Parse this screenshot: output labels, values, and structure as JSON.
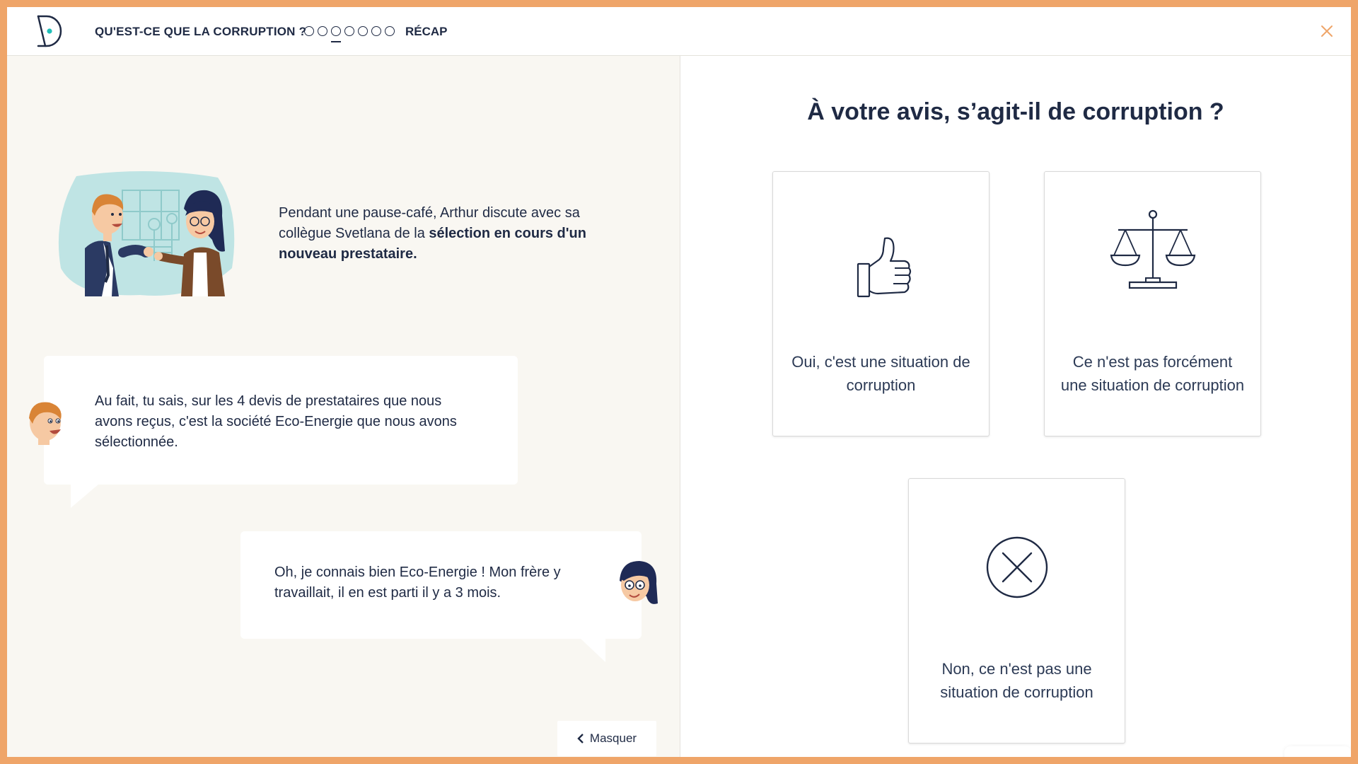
{
  "header": {
    "section_title": "QU'EST-CE QUE LA CORRUPTION ?",
    "recap_label": "RÉCAP",
    "steps_total": 7,
    "current_step": 3
  },
  "scene": {
    "intro_before": "Pendant une pause-café, Arthur discute avec sa collègue Svetlana de la ",
    "intro_bold": "sélection en cours d'un nouveau prestataire.",
    "dialogue": [
      {
        "speaker": "Arthur",
        "text": "Au fait, tu sais, sur les 4 devis de prestataires que nous avons reçus, c'est la société Eco-Energie que nous avons sélectionnée."
      },
      {
        "speaker": "Svetlana",
        "text": "Oh, je connais bien Eco-Energie ! Mon frère y travaillait, il en est parti il y a 3 mois."
      }
    ],
    "hide_label": "Masquer"
  },
  "quiz": {
    "question": "À votre avis, s’agit-il de corruption ?",
    "options": [
      {
        "label": "Oui, c'est une situation de corruption",
        "icon": "thumbs-up-icon"
      },
      {
        "label": "Ce n'est pas forcément une situation de corruption",
        "icon": "balance-scale-icon"
      },
      {
        "label": "Non, ce n'est pas une situation de corruption",
        "icon": "x-circle-icon"
      }
    ]
  },
  "colors": {
    "border_accent": "#efa569",
    "ink": "#1f2a44",
    "logo_dot": "#1fbfb8",
    "next_arrow": "#bfe9e7"
  }
}
